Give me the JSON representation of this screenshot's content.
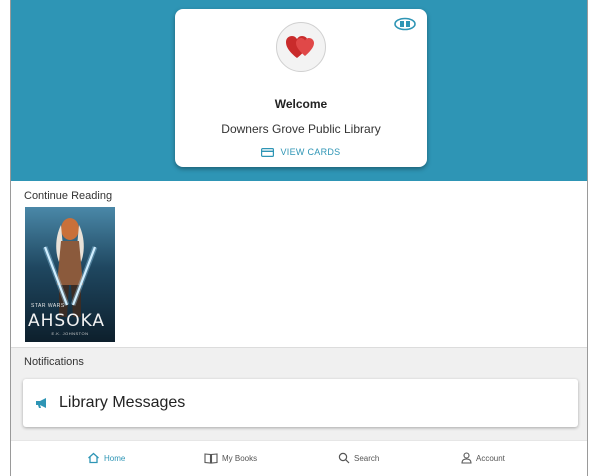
{
  "header": {
    "welcome_title": "Welcome",
    "library_name": "Downers Grove Public Library",
    "view_cards_label": "VIEW CARDS"
  },
  "continue_reading": {
    "label": "Continue Reading",
    "books": [
      {
        "cover_author": "E.K. JOHNSTON",
        "cover_title": "AHSOKA",
        "cover_brand": "STAR WARS"
      }
    ]
  },
  "notifications": {
    "label": "Notifications",
    "items": [
      {
        "label": "Library Messages",
        "icon": "megaphone-icon"
      }
    ]
  },
  "bottom_nav": {
    "items": [
      {
        "label": "Home",
        "icon": "home-icon",
        "active": true
      },
      {
        "label": "My Books",
        "icon": "book-icon",
        "active": false
      },
      {
        "label": "Search",
        "icon": "search-icon",
        "active": false
      },
      {
        "label": "Account",
        "icon": "account-icon",
        "active": false
      }
    ]
  },
  "colors": {
    "brand": "#2e95b5",
    "logo_red": "#d63a3a",
    "notification_band": "#f0f0f0"
  }
}
